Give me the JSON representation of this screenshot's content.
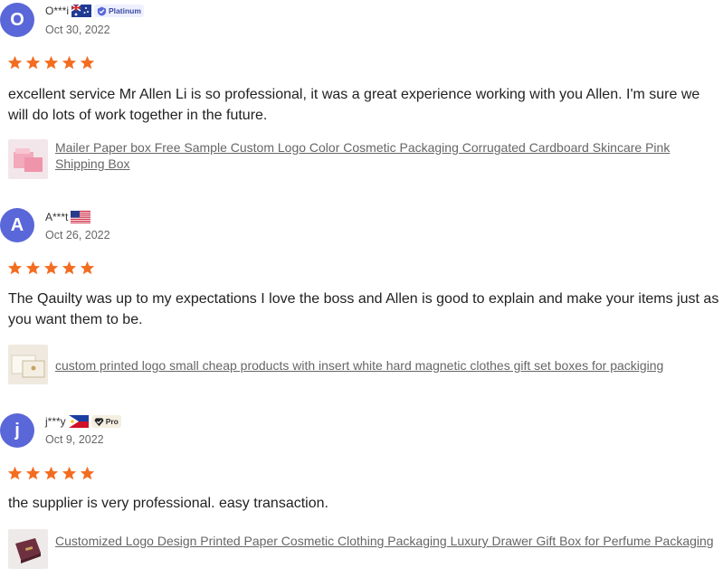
{
  "colors": {
    "star": "#f36d21",
    "avatar": "#5a67d8",
    "link": "#666666"
  },
  "reviews": [
    {
      "initial": "O",
      "name": "O***i",
      "country_flag": "australia-flag",
      "badge": "Platinum",
      "date": "Oct 30, 2022",
      "rating": 5,
      "text": "excellent service Mr Allen Li is so professional, it was a great experience working with you Allen. I'm sure we will do lots of work together in the future.",
      "product_link": "Mailer Paper box Free Sample Custom Logo Color Cosmetic Packaging Corrugated Cardboard Skincare Pink Shipping Box"
    },
    {
      "initial": "A",
      "name": "A***t",
      "country_flag": "usa-flag",
      "badge": "",
      "date": "Oct 26, 2022",
      "rating": 5,
      "text": "The Qauilty was up to my expectations I love the boss and Allen is good to explain and make your items just as you want them to be.",
      "product_link": "custom printed logo small cheap products with insert white hard magnetic clothes gift set boxes for packiging"
    },
    {
      "initial": "j",
      "name": "j***y",
      "country_flag": "philippines-flag",
      "badge": "Pro",
      "date": "Oct 9, 2022",
      "rating": 5,
      "text": "the supplier is very professional. easy transaction.",
      "product_link": "Customized Logo Design Printed Paper Cosmetic Clothing Packaging Luxury Drawer Gift Box for Perfume Packaging"
    }
  ]
}
